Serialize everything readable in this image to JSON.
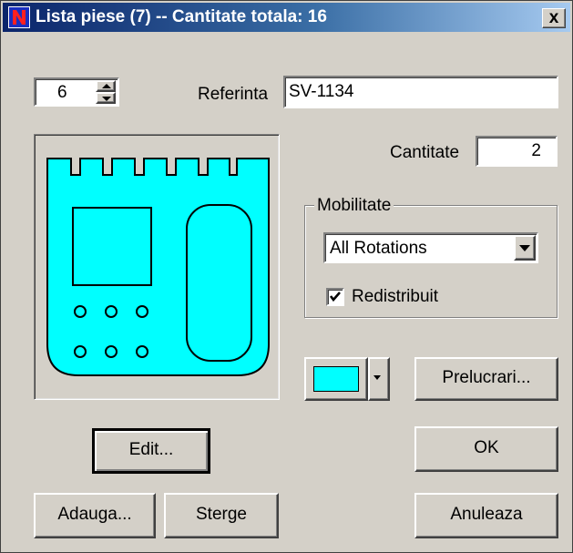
{
  "window": {
    "title": "Lista piese (7) -- Cantitate totala: 16",
    "close_glyph": "x"
  },
  "piece_spinner": {
    "value": "6"
  },
  "reference": {
    "label": "Referinta",
    "value": "SV-1134"
  },
  "quantity": {
    "label": "Cantitate",
    "value": "2"
  },
  "mobility": {
    "group_label": "Mobilitate",
    "selected_option": "All Rotations",
    "redistribute": {
      "label": "Redistribuit",
      "checked": true
    }
  },
  "color": {
    "swatch": "#00ffff",
    "icon": "chevron-down-icon"
  },
  "buttons": {
    "process": "Prelucrari...",
    "edit": "Edit...",
    "ok": "OK",
    "add": "Adauga...",
    "delete": "Sterge",
    "cancel": "Anuleaza"
  },
  "preview": {
    "fill_color": "#00ffff"
  }
}
